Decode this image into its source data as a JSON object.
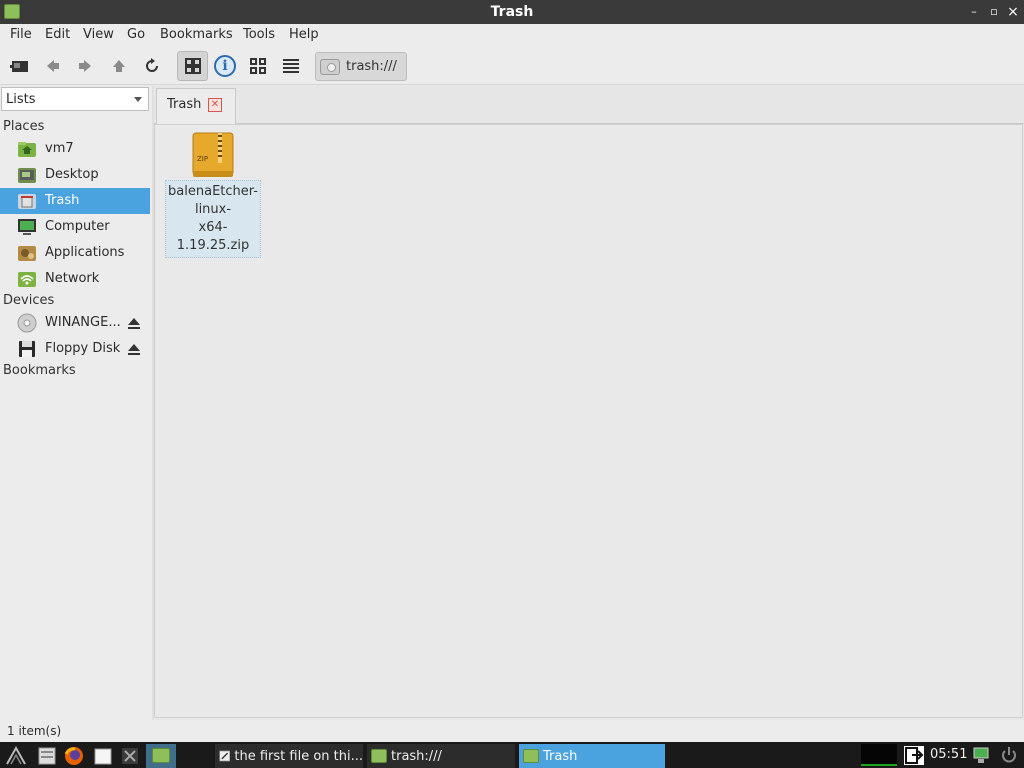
{
  "window": {
    "title": "Trash",
    "minimize": "–",
    "maximize": "▫",
    "close": "×"
  },
  "menu": [
    "File",
    "Edit",
    "View",
    "Go",
    "Bookmarks",
    "Tools",
    "Help"
  ],
  "toolbar": {
    "location": "trash:///",
    "icons": [
      "terminal-icon",
      "back-icon",
      "forward-icon",
      "up-icon",
      "reload-icon",
      "icon-view-toggle",
      "info-icon",
      "grid-view-icon",
      "list-view-icon"
    ]
  },
  "sidebar": {
    "combo": "Lists",
    "places_heading": "Places",
    "places": [
      {
        "label": "vm7",
        "icon": "home-folder-icon"
      },
      {
        "label": "Desktop",
        "icon": "desktop-folder-icon"
      },
      {
        "label": "Trash",
        "icon": "trash-icon",
        "selected": true
      },
      {
        "label": "Computer",
        "icon": "computer-icon"
      },
      {
        "label": "Applications",
        "icon": "applications-icon"
      },
      {
        "label": "Network",
        "icon": "network-icon"
      }
    ],
    "devices_heading": "Devices",
    "devices": [
      {
        "label": "WINANGE...",
        "icon": "cdrom-icon"
      },
      {
        "label": "Floppy Disk",
        "icon": "floppy-icon"
      }
    ],
    "bookmarks_heading": "Bookmarks"
  },
  "tab": {
    "label": "Trash"
  },
  "files": [
    {
      "name": "balenaEtcher-linux-x64-1.19.25.zip",
      "lines": [
        "balenaEtcher-",
        "linux-",
        "x64-1.19.25.zip"
      ],
      "badge": "ZIP"
    }
  ],
  "status": "1 item(s)",
  "taskbar": {
    "tasks": [
      {
        "label": "the first file on thi...",
        "active": false
      },
      {
        "label": "trash:///",
        "active": false
      },
      {
        "label": "Trash",
        "active": true
      }
    ],
    "clock": "05:51"
  },
  "colors": {
    "selection": "#4aa3df",
    "folder_green": "#8fbf5a"
  }
}
